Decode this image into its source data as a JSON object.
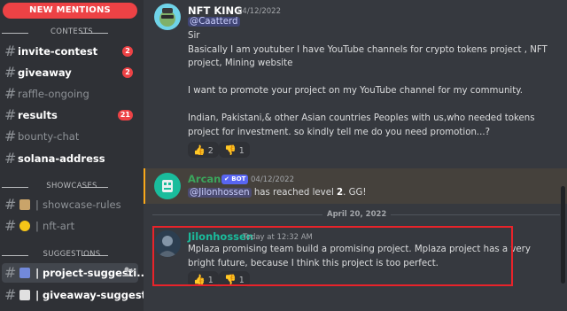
{
  "sidebar": {
    "mentions_label": "NEW MENTIONS",
    "categories": {
      "contests": "CONTESTS",
      "showcases": "SHOWCASES",
      "suggestions": "SUGGESTIONS"
    },
    "channels": [
      {
        "name": "invite-contest",
        "badge": "2"
      },
      {
        "name": "giveaway",
        "badge": "2"
      },
      {
        "name": "raffle-ongoing"
      },
      {
        "name": "results",
        "badge": "21"
      },
      {
        "name": "bounty-chat"
      },
      {
        "name": "solana-address"
      },
      {
        "name": "showcase-rules",
        "prefix": "|"
      },
      {
        "name": "nft-art",
        "prefix": "|"
      },
      {
        "name": "project-suggesti...",
        "prefix": "|"
      },
      {
        "name": "giveaway-suggest...",
        "prefix": "|"
      }
    ]
  },
  "messages": [
    {
      "author": "NFT KING",
      "timestamp": "04/12/2022",
      "mention": "@Caatterd",
      "lines": [
        "Sir",
        "Basically I am youtuber I have YouTube channels for crypto tokens project , NFT",
        "project, Mining website",
        "I want to promote your project on my YouTube channel for my community.",
        "Indian, Pakistani,& other Asian  countries Peoples with us,who needed tokens",
        "project for investment. so kindly tell me do you need promotion...?"
      ],
      "reactions": [
        {
          "emoji": "👍",
          "count": "2"
        },
        {
          "emoji": "👎",
          "count": "1"
        }
      ]
    },
    {
      "author": "Arcane",
      "bot_tag": "✔ BOT",
      "timestamp": "04/12/2022",
      "mention": "@Jilonhossen",
      "text_a": " has reached level ",
      "level": "2",
      "text_b": ". GG!"
    },
    {
      "author": "Jilonhossen",
      "timestamp": "Today at 12:32 AM",
      "lines": [
        "Mplaza promising team build a promising project. Mplaza project has a very",
        "bright future, because I think this project is too perfect."
      ],
      "reactions": [
        {
          "emoji": "👍",
          "count": "1"
        },
        {
          "emoji": "👎",
          "count": "1"
        }
      ]
    }
  ],
  "date_divider": "April 20, 2022",
  "colors": {
    "accent": "#ed4245",
    "nft_king_name": "#ffffff",
    "arcane_name": "#3ba55c",
    "jilon_name": "#1abc9c",
    "mention": "#c9cdfb"
  }
}
